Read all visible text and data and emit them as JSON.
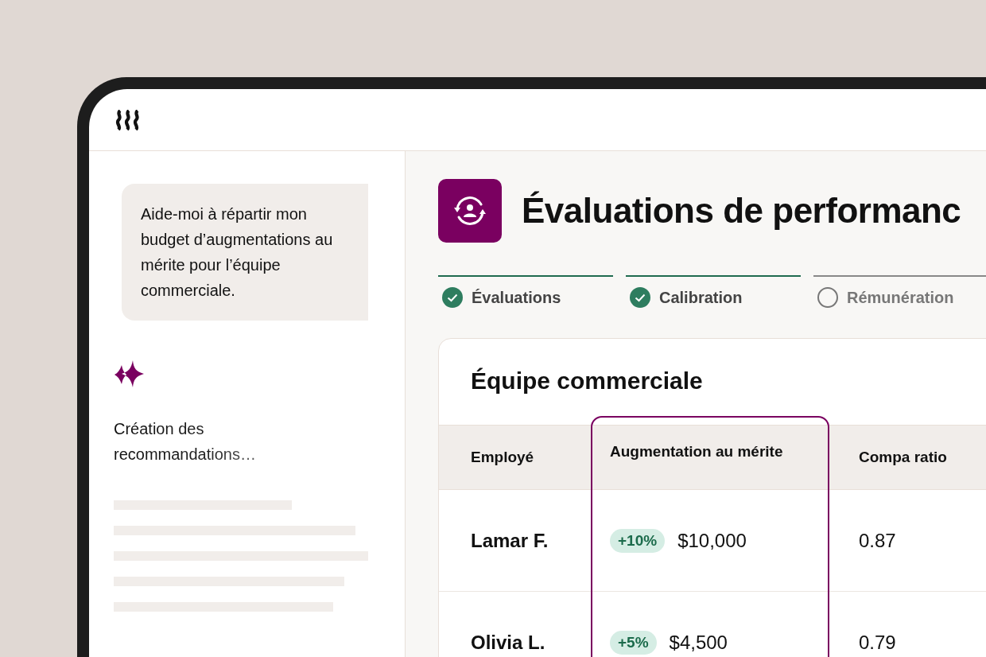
{
  "chat": {
    "message": "Aide-moi à répartir mon budget d’augmentations au mérite pour l’équipe commerciale.",
    "status": "Création des recommandations…"
  },
  "page": {
    "title": "Évaluations de performanc"
  },
  "steps": [
    {
      "label": "Évaluations",
      "done": true
    },
    {
      "label": "Calibration",
      "done": true
    },
    {
      "label": "Rémunération",
      "done": false
    }
  ],
  "table": {
    "title": "Équipe commerciale",
    "columns": [
      {
        "label": "Employé",
        "selected": false
      },
      {
        "label": "Augmentation au mérite",
        "selected": true
      },
      {
        "label": "Compa ratio",
        "selected": false
      }
    ],
    "rows": [
      {
        "name": "Lamar F.",
        "change": "+10%",
        "amount": "$10,000",
        "compa_ratio": "0.87"
      },
      {
        "name": "Olivia L.",
        "change": "+5%",
        "amount": "$4,500",
        "compa_ratio": "0.79"
      }
    ]
  }
}
